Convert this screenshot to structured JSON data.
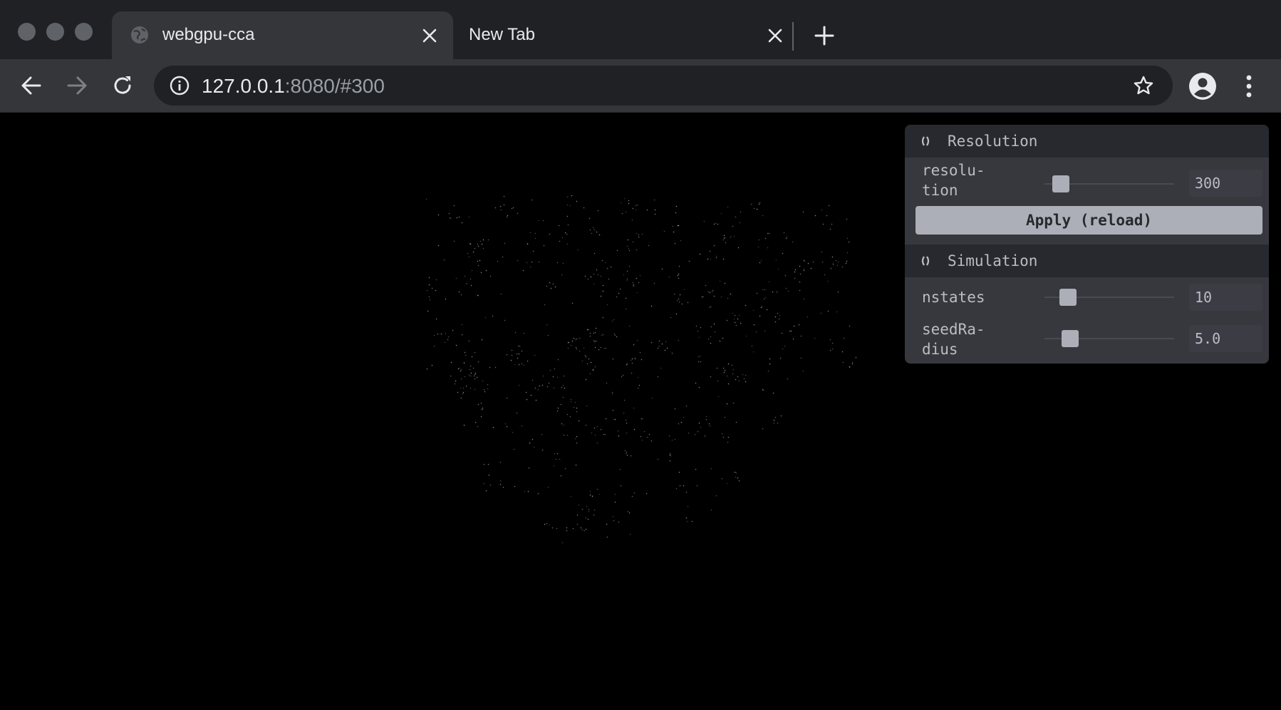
{
  "window": {
    "tabs": [
      {
        "title": "webgpu-cca",
        "active": true
      },
      {
        "title": "New Tab",
        "active": false
      }
    ]
  },
  "toolbar": {
    "url_host": "127.0.0.1",
    "url_rest": ":8080/#300"
  },
  "gui": {
    "resolution_folder": {
      "title": "Resolution",
      "resolution_label": "resolu-\ntion",
      "resolution_value": "300",
      "resolution_fraction": 0.11,
      "apply_label": "Apply (reload)"
    },
    "simulation_folder": {
      "title": "Simulation",
      "nstates_label": "nstates",
      "nstates_value": "10",
      "nstates_fraction": 0.17,
      "seedradius_label": "seedRa-\ndius",
      "seedradius_value": "5.0",
      "seedradius_fraction": 0.18
    }
  },
  "colors": {
    "chrome_bg": "#202124",
    "toolbar_bg": "#35363a",
    "panel_bg": "#28292e",
    "panel_row": "#37383d",
    "button": "#adafb8",
    "canvas_bg": "#000000"
  },
  "icons": {
    "tab_favicon": "globe-icon",
    "back": "arrow-left-icon",
    "forward": "arrow-right-icon",
    "reload": "reload-icon",
    "site_info": "info-icon",
    "bookmark": "star-icon",
    "profile": "account-icon",
    "menu": "kebab-menu-icon"
  }
}
